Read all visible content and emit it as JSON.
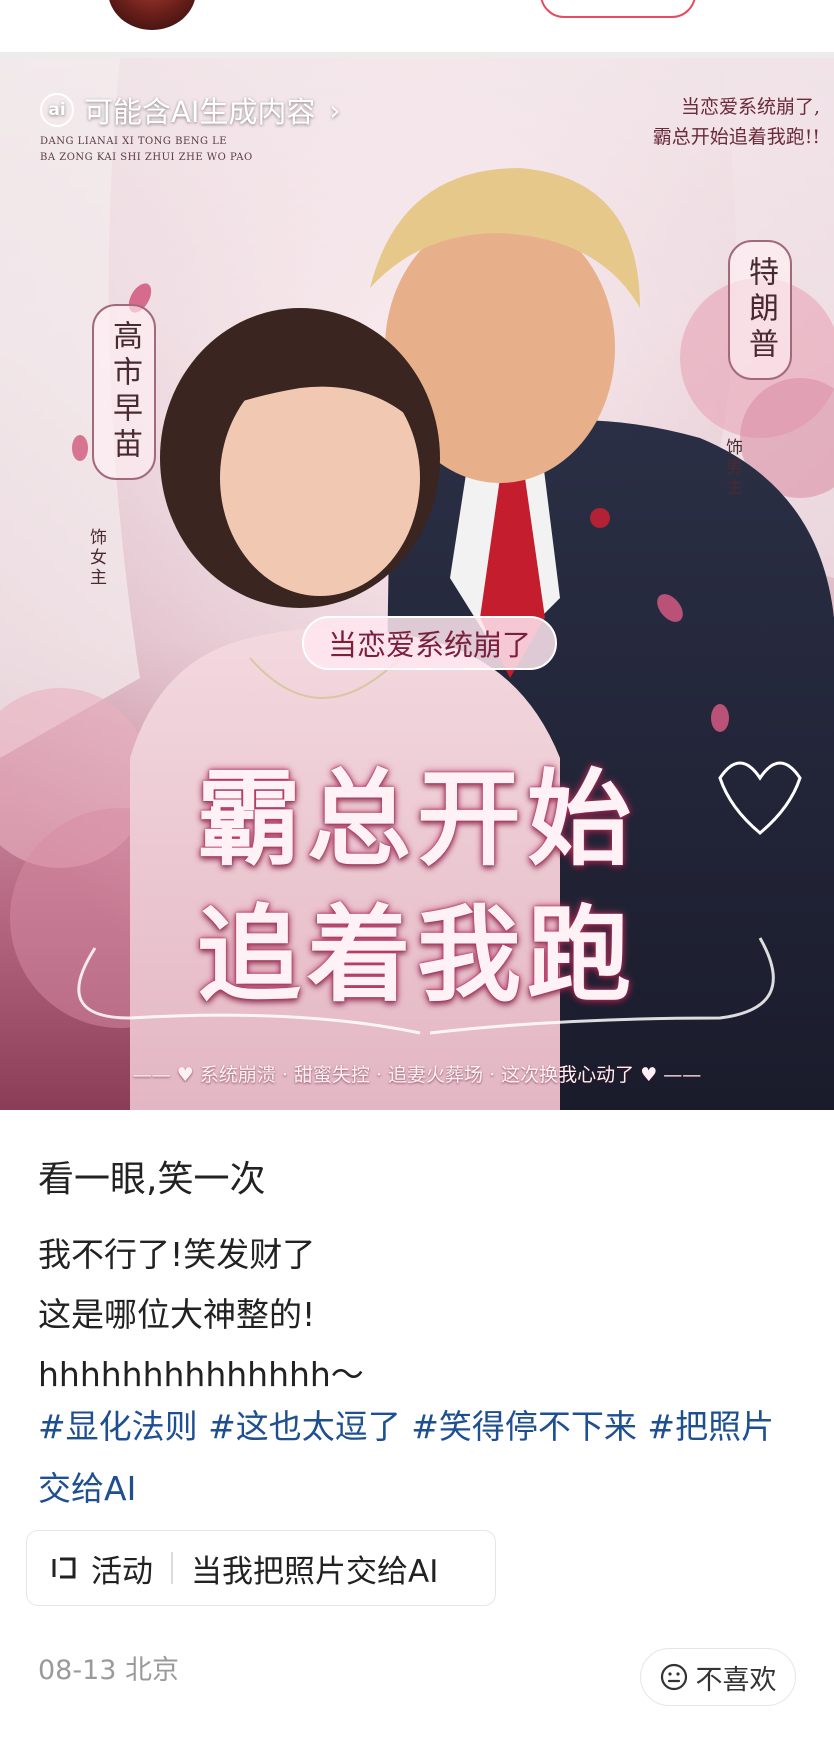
{
  "ai_badge": {
    "icon_text": "ai",
    "label": "可能含AI生成内容",
    "chevron": "›"
  },
  "poster": {
    "pinyin_line1": "DANG LIANAI XI TONG BENG LE",
    "pinyin_line2": "BA ZONG KAI SHI ZHUI ZHE WO PAO",
    "corner_caption_line1": "当恋爱系统崩了,",
    "corner_caption_line2": "霸总开始追着我跑!!",
    "heroine_name": "高市早苗",
    "heroine_role": "饰女主",
    "hero_name": "特朗普",
    "hero_role": "饰男主",
    "subtitle": "当恋爱系统崩了",
    "title_line1": "霸总开始",
    "title_line2": "追着我跑",
    "tagline": "—— ♥ 系统崩溃 · 甜蜜失控 · 追妻火葬场 · 这次换我心动了 ♥ ——"
  },
  "post": {
    "title": "看一眼,笑一次",
    "line1": "我不行了!笑发财了",
    "line2": "这是哪位大神整的!",
    "line3": "hhhhhhhhhhhhhh～",
    "hashtags": [
      "#显化法则",
      "#这也太逗了",
      "#笑得停不下来",
      "#把照片交给AI"
    ]
  },
  "activity": {
    "label": "活动",
    "topic": "当我把照片交给AI"
  },
  "meta": {
    "date": "08-13",
    "location": "北京"
  },
  "dislike": {
    "label": "不喜欢"
  },
  "colors": {
    "hashtag": "#1d4f91",
    "accent": "#e84a5f",
    "meta_gray": "#9a9a9a"
  }
}
